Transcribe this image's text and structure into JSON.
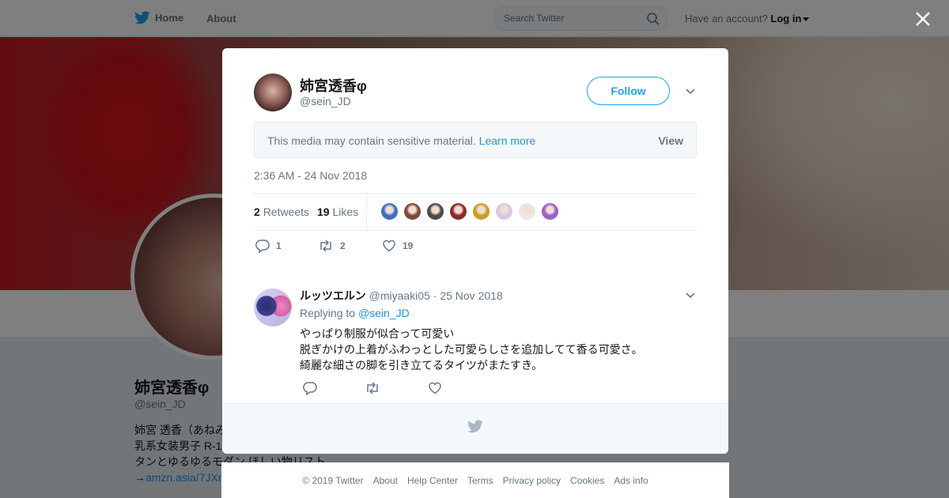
{
  "topbar": {
    "home_label": "Home",
    "about_label": "About",
    "search_placeholder": "Search Twitter",
    "account_prefix": "Have an account?",
    "login_label": "Log in"
  },
  "profile": {
    "name": "姉宮透香φ",
    "handle": "@sein_JD",
    "bio_lines": [
      "姉宮 透香（あねみ",
      "乳系女装男子 R-1",
      "タンとゆるゆるモダン ほしい物リスト"
    ],
    "bio_link_prefix": "→",
    "bio_link": "amzn.asia/7JXn"
  },
  "tweet": {
    "author_name": "姉宮透香φ",
    "author_handle": "@sein_JD",
    "follow_label": "Follow",
    "sensitive_msg": "This media may contain sensitive material.",
    "learn_more": "Learn more",
    "view_label": "View",
    "timestamp": "2:36 AM - 24 Nov 2018",
    "retweets_count": "2",
    "retweets_label": "Retweets",
    "likes_count": "19",
    "likes_label": "Likes",
    "action_reply_count": "1",
    "action_retweet_count": "2",
    "action_like_count": "19",
    "liker_colors": [
      "#3a6fc9",
      "#7a4a3a",
      "#4a4a4a",
      "#8a2a2a",
      "#c9a020",
      "#d6c8e0",
      "#e8e8e8",
      "#9a5fc9"
    ]
  },
  "reply": {
    "name": "ルッツエルン",
    "handle": "@miyaaki05",
    "date": "· 25 Nov 2018",
    "replying_prefix": "Replying to",
    "replying_to": "@sein_JD",
    "lines": [
      "やっぱり制服が似合って可愛い",
      "脱ぎかけの上着がふわっとした可愛らしさを追加してて香る可愛さ。",
      "綺麗な細さの脚を引き立てるタイツがまたすき。"
    ]
  },
  "footer": {
    "links": [
      "© 2019 Twitter",
      "About",
      "Help Center",
      "Terms",
      "Privacy policy",
      "Cookies",
      "Ads info"
    ]
  },
  "colors": {
    "accent": "#1da1f2",
    "link": "#1b95e0",
    "muted": "#657786"
  }
}
